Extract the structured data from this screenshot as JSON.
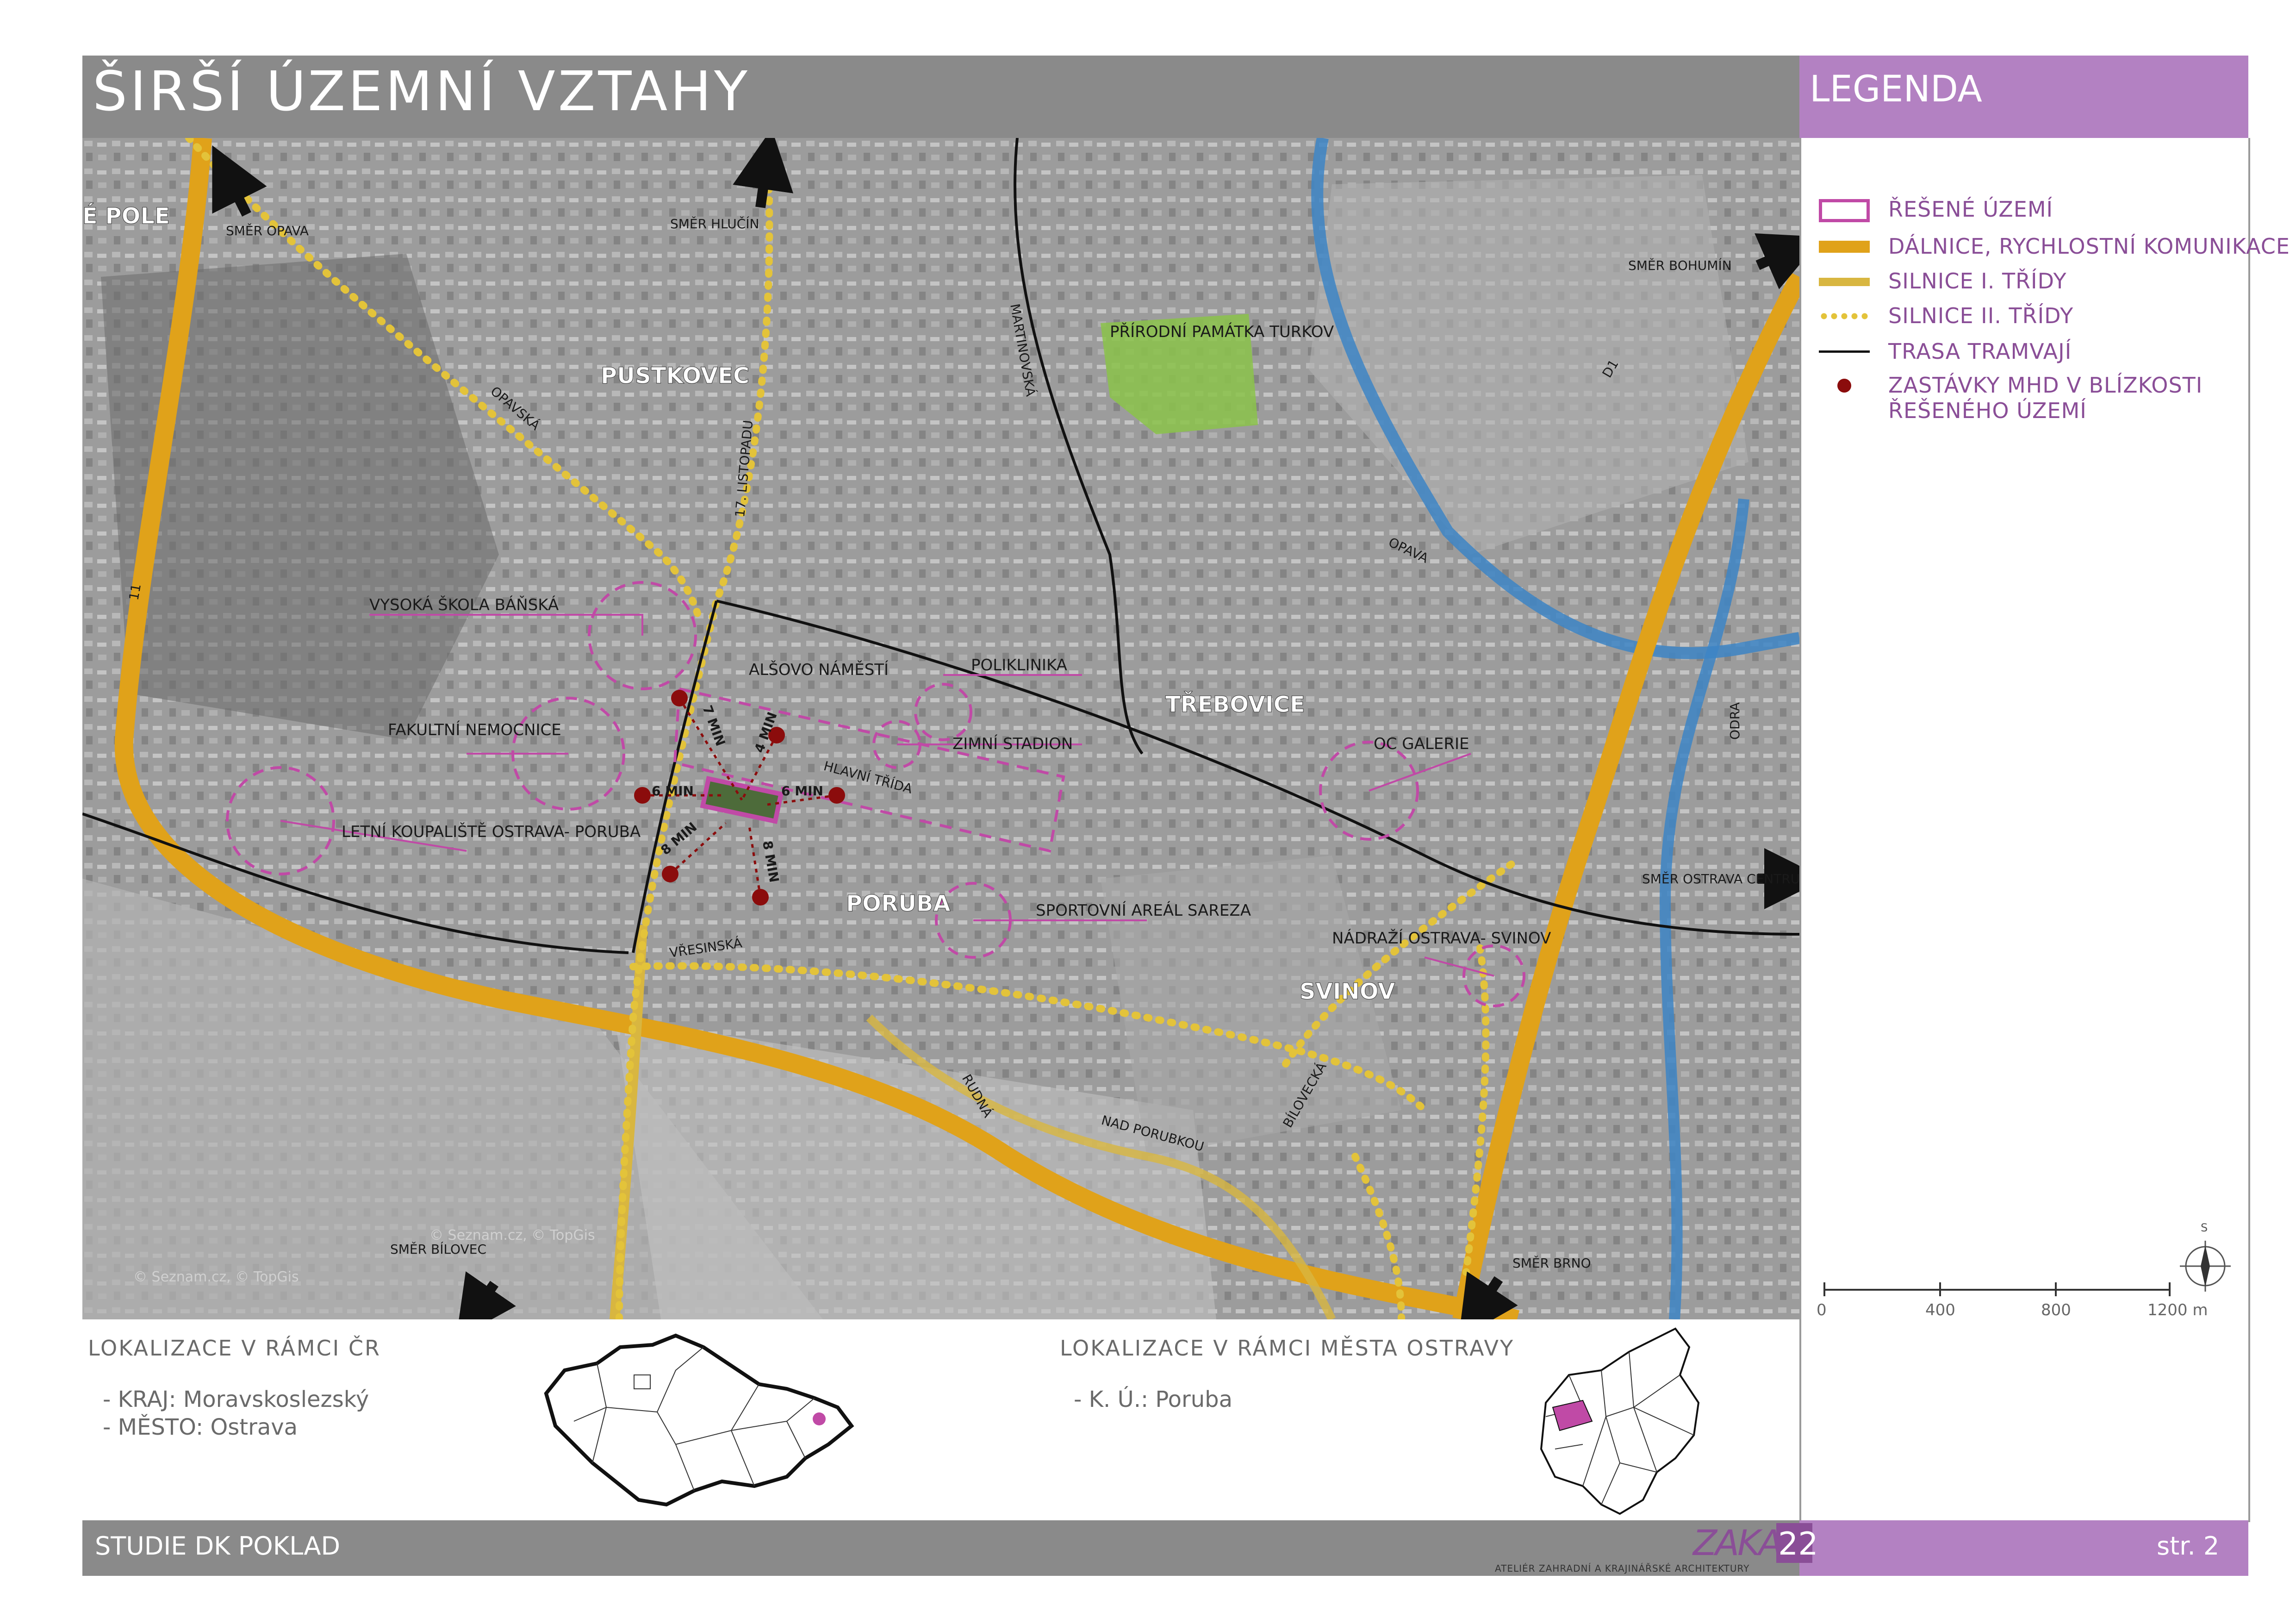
{
  "title": "ŠIRŠÍ ÚZEMNÍ VZTAHY",
  "legend": {
    "title": "LEGENDA",
    "items": [
      {
        "label": "ŘEŠENÉ ÚZEMÍ",
        "icon": "magenta-outline-rectangle",
        "color": "#b03a9a"
      },
      {
        "label": "DÁLNICE, RYCHLOSTNÍ KOMUNIKACE",
        "icon": "thick-orange-line",
        "color": "#e0a21a"
      },
      {
        "label": "SILNICE I. TŘÍDY",
        "icon": "yellow-line",
        "color": "#d8b640"
      },
      {
        "label": "SILNICE II. TŘÍDY",
        "icon": "yellow-dotted-line",
        "color": "#e3c33a"
      },
      {
        "label": "TRASA TRAMVAJÍ",
        "icon": "black-line",
        "color": "#111111"
      },
      {
        "label": "ZASTÁVKY MHD V BLÍZKOSTI ŘEŠENÉHO ÚZEMÍ",
        "label_lines": [
          "ZASTÁVKY MHD V BLÍZKOSTI",
          "ŘEŠENÉHO ÚZEMÍ"
        ],
        "icon": "dark-red-dot",
        "color": "#8b0c0c"
      }
    ],
    "scale": {
      "labels": [
        "0",
        "400",
        "800",
        "1200 m"
      ]
    },
    "north_arrow": {
      "label": "S",
      "icon": "compass-icon"
    }
  },
  "map": {
    "districts": [
      "PUSTKOVEC",
      "TŘEBOVICE",
      "PORUBA",
      "SVINOV",
      "É POLE"
    ],
    "places": [
      "VYSOKÁ ŠKOLA BÁŇSKÁ",
      "FAKULTNÍ NEMOCNICE",
      "LETNÍ KOUPALIŠTĚ OSTRAVA- PORUBA",
      "ALŠOVO NÁMĚSTÍ",
      "POLIKLINIKA",
      "ZIMNÍ STADION",
      "SPORTOVNÍ AREÁL SAREZA",
      "OC GALERIE",
      "NÁDRAŽÍ OSTRAVA- SVINOV",
      "PŘÍRODNÍ PAMÁTKA TURKOV"
    ],
    "directions": [
      "SMĚR OPAVA",
      "SMĚR HLUČÍN",
      "SMĚR BOHUMÍN",
      "SMĚR OSTRAVA CENTRUM",
      "SMĚR BÍLOVEC",
      "SMĚR BRNO"
    ],
    "streets": [
      "OPAVSKÁ",
      "17. LISTOPADU",
      "MARTINOVSKÁ",
      "HLAVNÍ TŘÍDA",
      "VŘESINSKÁ",
      "RUDNÁ",
      "NAD PORUBKOU",
      "BÍLOVECKÁ",
      "OPAVA",
      "ODRA",
      "11",
      "D1"
    ],
    "walk_times": [
      "7 MIN",
      "4 MIN",
      "6 MIN",
      "6 MIN",
      "8 MIN",
      "8 MIN"
    ],
    "credits": [
      "© Seznam.cz, © TopGis",
      "© Seznam.cz, © TopGis"
    ]
  },
  "localization_cr": {
    "title": "LOKALIZACE V RÁMCI ČR",
    "items": [
      "- KRAJ: Moravskoslezský",
      "- MĚSTO: Ostrava"
    ]
  },
  "localization_city": {
    "title": "LOKALIZACE V RÁMCI MĚSTA OSTRAVY",
    "items": [
      "- K. Ú.: Poruba"
    ]
  },
  "footer": {
    "project": "STUDIE DK POKLAD",
    "logo": "ZAKA",
    "logo_number": "22",
    "studio": "ATELIÉR ZAHRADNÍ A KRAJINÁŘSKÉ ARCHITEKTURY",
    "page": "str. 2"
  }
}
